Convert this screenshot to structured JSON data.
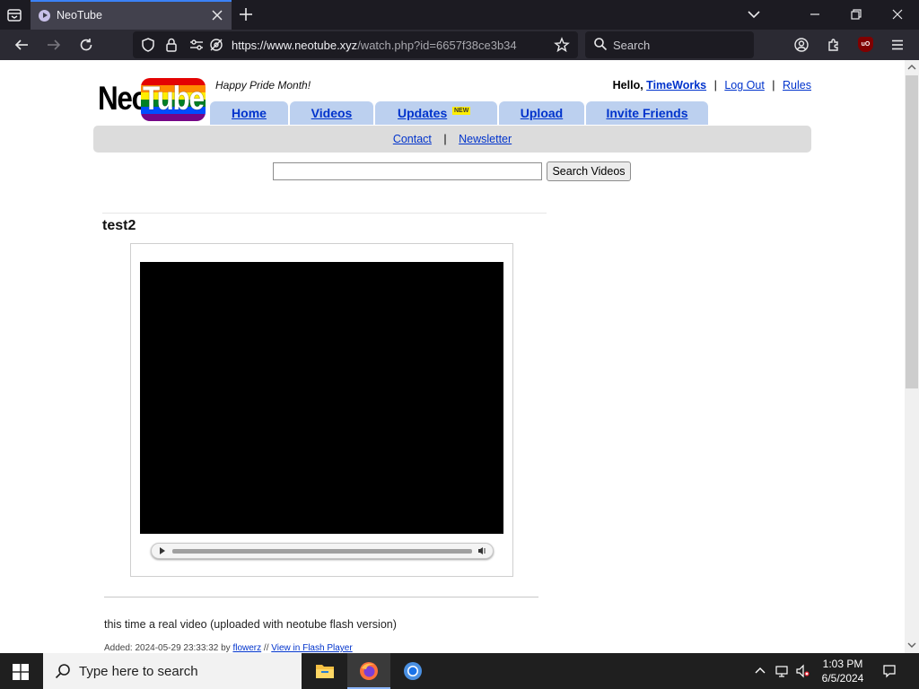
{
  "browser": {
    "tab_title": "NeoTube",
    "url_host": "https://www.neotube.xyz",
    "url_path": "/watch.php?id=6657f38ce3b34",
    "search_placeholder": "Search"
  },
  "site": {
    "logo_neo": "Neo",
    "logo_tube": "Tube",
    "tagline": "Happy Pride Month!",
    "hello": "Hello,",
    "username": "TimeWorks",
    "logout": "Log Out",
    "rules": "Rules",
    "sep": "|",
    "nav": {
      "home": "Home",
      "videos": "Videos",
      "updates": "Updates",
      "new_badge": "NEW",
      "upload": "Upload",
      "invite": "Invite Friends"
    },
    "subnav": {
      "contact": "Contact",
      "newsletter": "Newsletter"
    },
    "search_button": "Search Videos",
    "search_value": ""
  },
  "video": {
    "title": "test2",
    "description": "this time a real video (uploaded with neotube flash version)",
    "added_label": "Added: 2024-05-29 23:33:32 by",
    "uploader": "flowerz",
    "meta_sep": "//",
    "flash_link": "View in Flash Player"
  },
  "taskbar": {
    "search_text": "Type here to search",
    "time": "1:03 PM",
    "date": "6/5/2024"
  },
  "colors": {
    "nav_tab": "#bcd0ef",
    "link": "#0033cc",
    "pride_stripes": [
      "#e40303",
      "#ff8c00",
      "#ffed00",
      "#008026",
      "#004dff",
      "#750787"
    ]
  }
}
